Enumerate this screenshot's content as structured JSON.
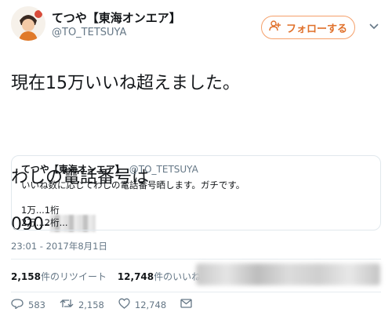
{
  "author": {
    "display_name": "てつや【東海オンエア】",
    "handle": "@TO_TETSUYA"
  },
  "follow_label": "フォローする",
  "tweet": {
    "line1": "現在15万いいね超えました。",
    "line2": "わしの電話番号は",
    "phone_prefix": "090-"
  },
  "quoted": {
    "name": "てつや【東海オンエア】",
    "handle": "@TO_TETSUYA",
    "text": "いいね数に応じてわしの電話番号晒します。ガチです。\n\n1万...1桁\n2万...2桁..."
  },
  "timestamp": "23:01 - 2017年8月1日",
  "stats": {
    "retweets_count": "2,158",
    "retweets_label": "件のリツイート",
    "likes_count": "12,748",
    "likes_label": "件のいいね"
  },
  "actions": {
    "reply_count": "583",
    "retweet_count": "2,158",
    "like_count": "12,748"
  },
  "colors": {
    "accent": "#e0702a",
    "muted": "#657786"
  }
}
